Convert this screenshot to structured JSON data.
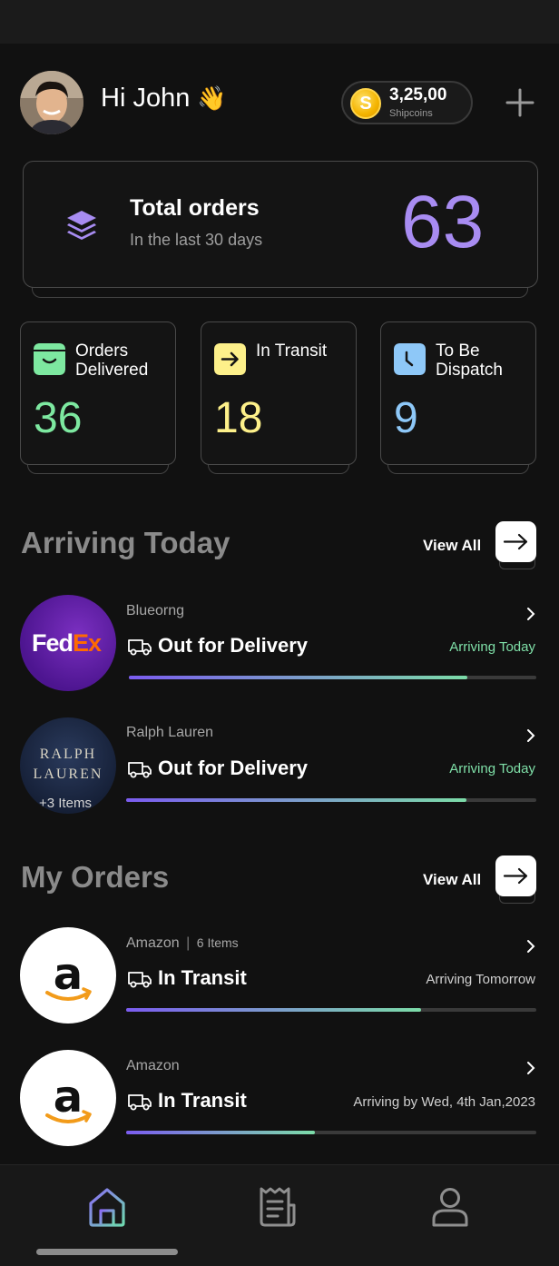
{
  "header": {
    "greeting": "Hi John",
    "wave_emoji": "👋",
    "coins_value": "3,25,00",
    "coins_label": "Shipcoins",
    "coin_symbol": "S"
  },
  "summary": {
    "title": "Total orders",
    "subtitle": "In the last 30 days",
    "count": "63"
  },
  "stats": [
    {
      "label": "Orders Delivered",
      "value": "36",
      "color": "#7de8a0",
      "icon": "box-smile-icon"
    },
    {
      "label": "In Transit",
      "value": "18",
      "color": "#fdf08a",
      "icon": "arrow-right-icon"
    },
    {
      "label": "To Be Dispatch",
      "value": "9",
      "color": "#8ec8f8",
      "icon": "clock-icon"
    }
  ],
  "arriving_today": {
    "title": "Arriving Today",
    "view_all": "View All",
    "items": [
      {
        "brand": "Blueorng",
        "logo": "fedex-logo",
        "logo_text_a": "Fed",
        "logo_text_b": "Ex",
        "status": "Out for Delivery",
        "eta": "Arriving Today",
        "progress": 0.83
      },
      {
        "brand": "Ralph Lauren",
        "logo": "ralph-lauren-logo",
        "logo_text_a": "RALPH",
        "logo_text_b": "LAUREN",
        "items_caption": "+3 Items",
        "status": "Out for Delivery",
        "eta": "Arriving Today",
        "progress": 0.83
      }
    ]
  },
  "my_orders": {
    "title": "My Orders",
    "view_all": "View All",
    "items": [
      {
        "brand": "Amazon",
        "items_count": "6 Items",
        "separator": "|",
        "logo": "amazon-logo",
        "status": "In Transit",
        "eta": "Arriving Tomorrow",
        "progress": 0.72
      },
      {
        "brand": "Amazon",
        "logo": "amazon-logo",
        "status": "In Transit",
        "eta": "Arriving by Wed, 4th Jan,2023",
        "progress": 0.46
      }
    ]
  },
  "nav": [
    {
      "name": "home",
      "icon": "home-icon",
      "active": true
    },
    {
      "name": "orders",
      "icon": "receipt-icon",
      "active": false
    },
    {
      "name": "profile",
      "icon": "user-icon",
      "active": false
    }
  ],
  "colors": {
    "accent_purple": "#a88cf2",
    "eta_green": "#7fe0a8",
    "eta_gray": "#d0d0d0",
    "background": "#111111"
  }
}
